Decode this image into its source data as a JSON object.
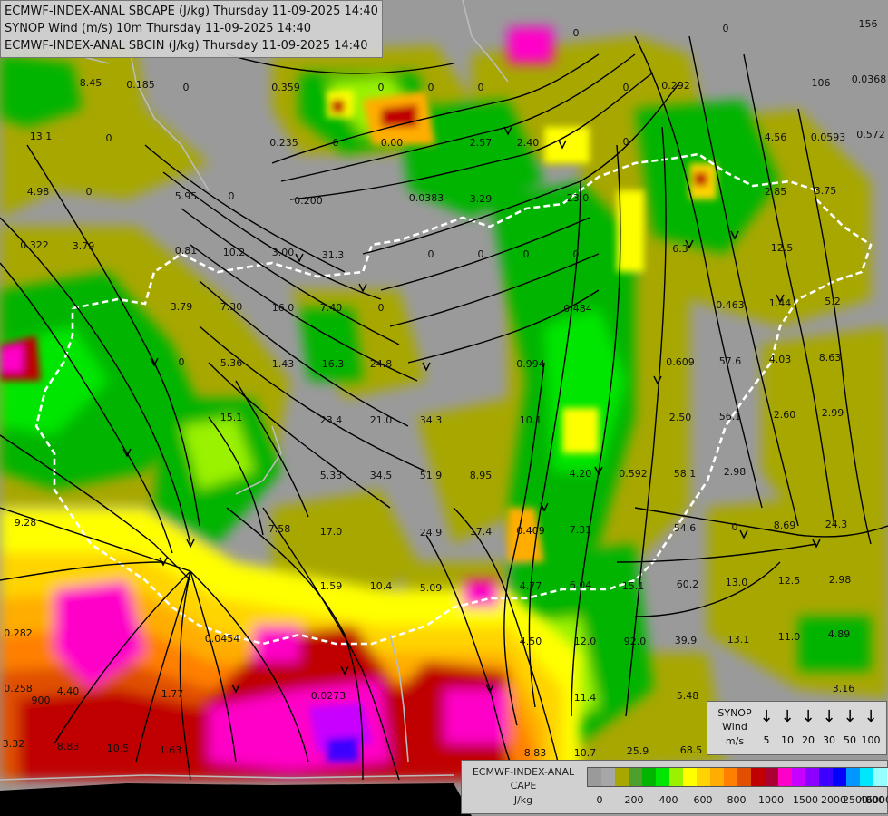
{
  "header": {
    "lines": [
      "ECMWF-INDEX-ANAL SBCAPE (J/kg) Thursday 11-09-2025 14:40",
      "SYNOP Wind (m/s) 10m Thursday 11-09-2025 14:40",
      "ECMWF-INDEX-ANAL SBCIN (J/kg) Thursday 11-09-2025 14:40"
    ]
  },
  "wind_legend": {
    "title_lines": [
      "SYNOP",
      "Wind",
      "m/s"
    ],
    "speeds": [
      "5",
      "10",
      "20",
      "30",
      "50",
      "100"
    ]
  },
  "cape_legend": {
    "title_lines": [
      "ECMWF-INDEX-ANAL",
      "CAPE",
      "J/kg"
    ],
    "colors": [
      "#9a9a9a",
      "#a6a6a6",
      "#a7a700",
      "#4f9f2d",
      "#00b400",
      "#00e600",
      "#9af200",
      "#ffff00",
      "#ffd400",
      "#ffad00",
      "#ff7f00",
      "#e05000",
      "#c00000",
      "#aa0033",
      "#ff00c8",
      "#c800ff",
      "#8c00ff",
      "#3c00ff",
      "#0000ff",
      "#0096ff",
      "#00e6ff",
      "#96ffff",
      "#ffffff"
    ],
    "ticks": [
      "0",
      "200",
      "400",
      "600",
      "800",
      "1000",
      "1500",
      "2000",
      "2500",
      "4000",
      "6000"
    ]
  },
  "map_values": [
    {
      "t": "8.45"
    },
    {
      "t": "0.185"
    },
    {
      "t": "0"
    },
    {
      "t": "0.359"
    },
    {
      "t": "0"
    },
    {
      "t": "0"
    },
    {
      "t": "0"
    },
    {
      "t": "0"
    },
    {
      "t": "0"
    },
    {
      "t": "0"
    },
    {
      "t": "156"
    },
    {
      "t": "0.0368"
    },
    {
      "t": "13.1"
    },
    {
      "t": "0"
    },
    {
      "t": "0.235"
    },
    {
      "t": "0"
    },
    {
      "t": "0.00"
    },
    {
      "t": "2.57"
    },
    {
      "t": "2.40"
    },
    {
      "t": "0"
    },
    {
      "t": "0.292"
    },
    {
      "t": "106"
    },
    {
      "t": "4.56"
    },
    {
      "t": "0.0593"
    },
    {
      "t": "0.572"
    },
    {
      "t": "4.98"
    },
    {
      "t": "0"
    },
    {
      "t": "5.95"
    },
    {
      "t": "0"
    },
    {
      "t": "0.200"
    },
    {
      "t": "0.0383"
    },
    {
      "t": "3.29"
    },
    {
      "t": "23.0"
    },
    {
      "t": "2.85"
    },
    {
      "t": "3.75"
    },
    {
      "t": "0.322"
    },
    {
      "t": "3.79"
    },
    {
      "t": "0.81"
    },
    {
      "t": "10.2"
    },
    {
      "t": "3.00"
    },
    {
      "t": "31.3"
    },
    {
      "t": "0"
    },
    {
      "t": "0"
    },
    {
      "t": "0"
    },
    {
      "t": "0"
    },
    {
      "t": "6.3"
    },
    {
      "t": "12.5"
    },
    {
      "t": "3.79"
    },
    {
      "t": "7.30"
    },
    {
      "t": "16.0"
    },
    {
      "t": "7.40"
    },
    {
      "t": "0"
    },
    {
      "t": "0.484"
    },
    {
      "t": "0.463"
    },
    {
      "t": "1.44"
    },
    {
      "t": "5.2"
    },
    {
      "t": "0"
    },
    {
      "t": "5.36"
    },
    {
      "t": "1.43"
    },
    {
      "t": "16.3"
    },
    {
      "t": "24.8"
    },
    {
      "t": "0.994"
    },
    {
      "t": "0.609"
    },
    {
      "t": "57.6"
    },
    {
      "t": "4.03"
    },
    {
      "t": "8.63"
    },
    {
      "t": "15.1"
    },
    {
      "t": "23.4"
    },
    {
      "t": "21.0"
    },
    {
      "t": "34.3"
    },
    {
      "t": "10.1"
    },
    {
      "t": "2.50"
    },
    {
      "t": "56.1"
    },
    {
      "t": "2.60"
    },
    {
      "t": "2.99"
    },
    {
      "t": "5.33"
    },
    {
      "t": "34.5"
    },
    {
      "t": "51.9"
    },
    {
      "t": "8.95"
    },
    {
      "t": "4.20"
    },
    {
      "t": "0.592"
    },
    {
      "t": "58.1"
    },
    {
      "t": "2.98"
    },
    {
      "t": "9.28"
    },
    {
      "t": "7.58"
    },
    {
      "t": "17.0"
    },
    {
      "t": "24.9"
    },
    {
      "t": "17.4"
    },
    {
      "t": "0.409"
    },
    {
      "t": "7.31"
    },
    {
      "t": "54.6"
    },
    {
      "t": "0"
    },
    {
      "t": "8.69"
    },
    {
      "t": "24.3"
    },
    {
      "t": "1.59"
    },
    {
      "t": "10.4"
    },
    {
      "t": "5.09"
    },
    {
      "t": "4.77"
    },
    {
      "t": "6.04"
    },
    {
      "t": "15.1"
    },
    {
      "t": "60.2"
    },
    {
      "t": "13.0"
    },
    {
      "t": "12.5"
    },
    {
      "t": "2.98"
    },
    {
      "t": "0.282"
    },
    {
      "t": "0.0454"
    },
    {
      "t": "4.50"
    },
    {
      "t": "12.0"
    },
    {
      "t": "92.0"
    },
    {
      "t": "39.9"
    },
    {
      "t": "13.1"
    },
    {
      "t": "11.0"
    },
    {
      "t": "4.89"
    },
    {
      "t": "0.258"
    },
    {
      "t": "4.40"
    },
    {
      "t": "900"
    },
    {
      "t": "1.77"
    },
    {
      "t": "0.0273"
    },
    {
      "t": "11.4"
    },
    {
      "t": "5.48"
    },
    {
      "t": "3.16"
    },
    {
      "t": "3.32"
    },
    {
      "t": "8.83"
    },
    {
      "t": "10.5"
    },
    {
      "t": "1.63"
    },
    {
      "t": "8.83"
    },
    {
      "t": "10.7"
    },
    {
      "t": "25.9"
    },
    {
      "t": "68.5"
    }
  ]
}
